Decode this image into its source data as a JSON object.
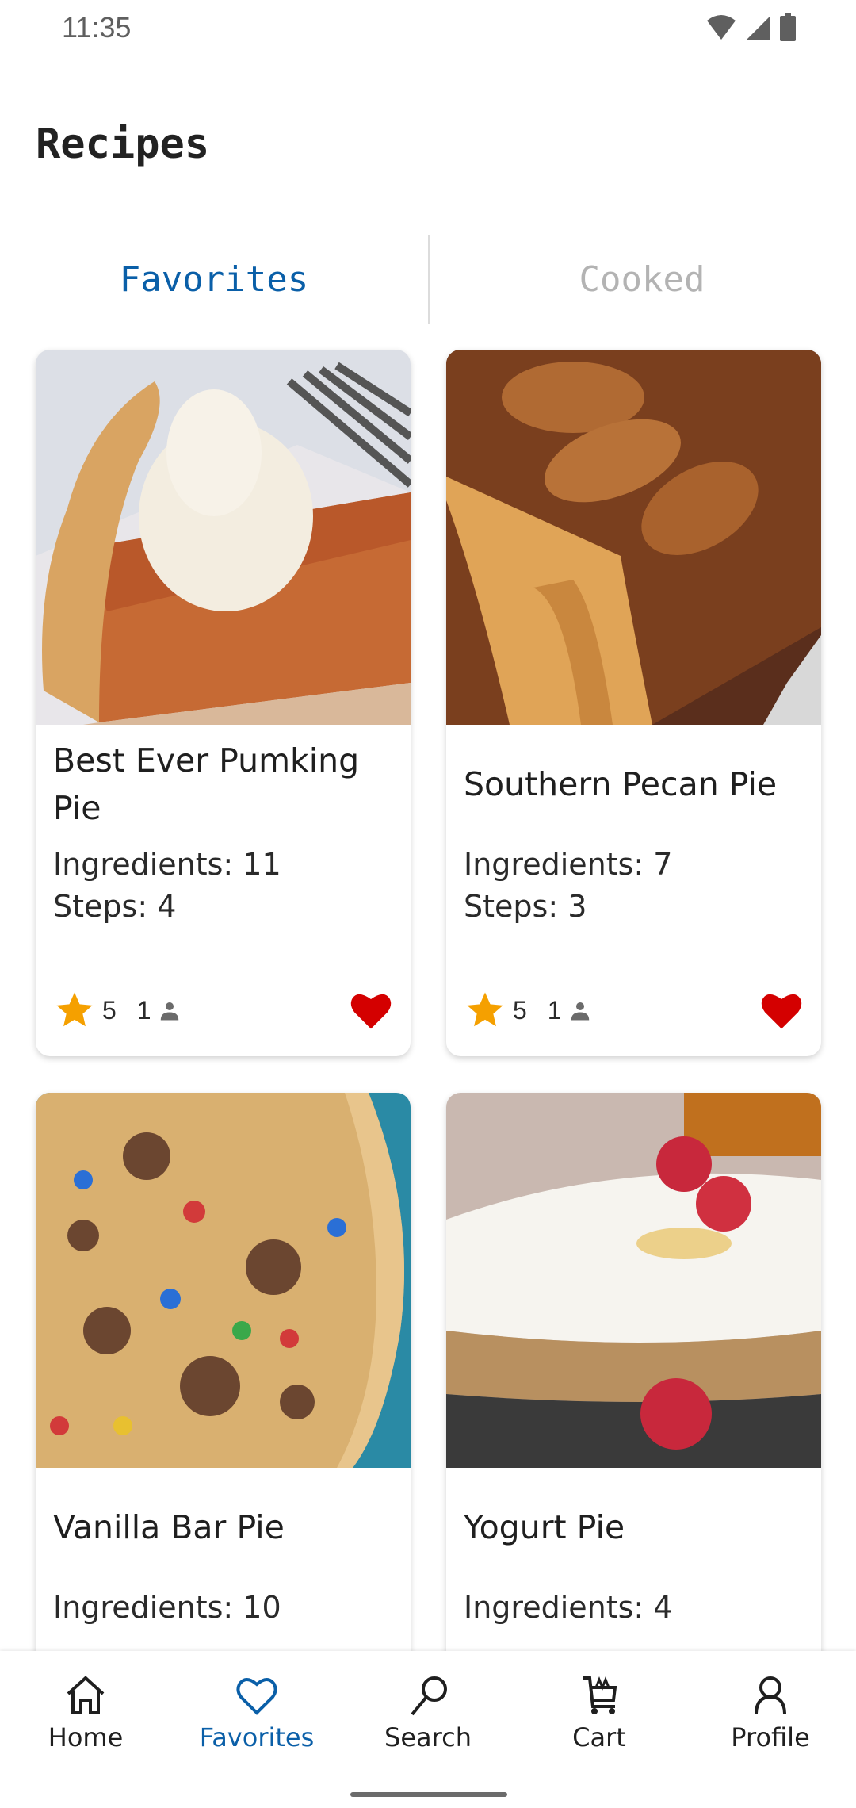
{
  "status_bar": {
    "time": "11:35",
    "icons": [
      "wifi-icon",
      "signal-icon",
      "battery-icon"
    ]
  },
  "header": {
    "title": "Recipes"
  },
  "tabs": [
    {
      "label": "Favorites",
      "active": true
    },
    {
      "label": "Cooked",
      "active": false
    }
  ],
  "colors": {
    "accent": "#0a5fa8",
    "star": "#f5a000",
    "heart": "#d40000",
    "inactive_tab": "#b3b3b3"
  },
  "recipes": [
    {
      "title": "Best Ever Pumking Pie",
      "ingredients": "Ingredients: 11",
      "steps": "Steps: 4",
      "rating": "5",
      "reviews": "1",
      "favorite": true,
      "image": "pumpkin-pie-photo"
    },
    {
      "title": "Southern Pecan Pie",
      "ingredients": "Ingredients: 7",
      "steps": "Steps: 3",
      "rating": "5",
      "reviews": "1",
      "favorite": true,
      "image": "pecan-pie-photo"
    },
    {
      "title": "Vanilla Bar Pie",
      "ingredients": "Ingredients: 10",
      "steps": "",
      "image": "cookie-pie-photo"
    },
    {
      "title": "Yogurt Pie",
      "ingredients": "Ingredients: 4",
      "steps": "",
      "image": "yogurt-pie-photo"
    }
  ],
  "bottom_nav": [
    {
      "label": "Home",
      "icon": "home-icon",
      "active": false
    },
    {
      "label": "Favorites",
      "icon": "heart-outline-icon",
      "active": true
    },
    {
      "label": "Search",
      "icon": "search-icon",
      "active": false
    },
    {
      "label": "Cart",
      "icon": "cart-icon",
      "active": false
    },
    {
      "label": "Profile",
      "icon": "profile-icon",
      "active": false
    }
  ]
}
